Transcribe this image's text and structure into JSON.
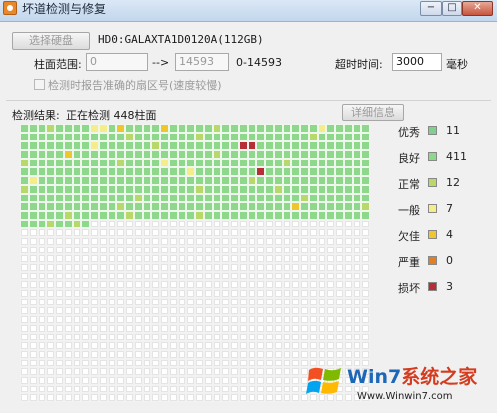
{
  "window": {
    "title": "坏道检测与修复",
    "min": "−",
    "max": "□",
    "close": "✕"
  },
  "toolbar": {
    "select_disk_label": "选择硬盘",
    "disk_info": "HD0:GALAXTA1D0120A(112GB)"
  },
  "range": {
    "label": "柱面范围:",
    "start": "0",
    "arrow": "-->",
    "end": "14593",
    "summary": "0-14593",
    "timeout_label": "超时时间:",
    "timeout_value": "3000",
    "timeout_unit": "毫秒"
  },
  "option": {
    "report_sector_label": "检测时报告准确的扇区号(速度较慢)",
    "checked": false
  },
  "result": {
    "label": "检测结果:",
    "status": "正在检测 448柱面",
    "detail_button": "详细信息"
  },
  "legend": [
    {
      "label": "优秀",
      "color": "#7fd08f",
      "count": "11"
    },
    {
      "label": "良好",
      "color": "#8dd88a",
      "count": "411"
    },
    {
      "label": "正常",
      "color": "#b8d96a",
      "count": "12"
    },
    {
      "label": "一般",
      "color": "#f5ec8a",
      "count": "7"
    },
    {
      "label": "欠佳",
      "color": "#efc62e",
      "count": "4"
    },
    {
      "label": "严重",
      "color": "#e07f26",
      "count": "0"
    },
    {
      "label": "损坏",
      "color": "#b72f36",
      "count": "3"
    }
  ],
  "scan_grid": {
    "columns": 40,
    "total_cells": 1280,
    "scanned_cells": 448
  },
  "watermark": {
    "brand_prefix": "Win7",
    "brand_suffix": "系统之家",
    "url": "Www.Winwin7.com"
  }
}
